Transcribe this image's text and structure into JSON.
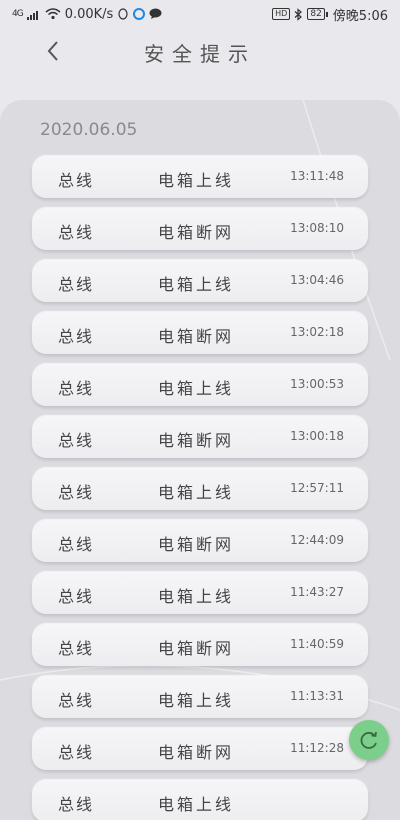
{
  "status_bar": {
    "signal": "4G",
    "speed": "0.00K/s",
    "hd": "HD",
    "battery": "82",
    "time": "傍晚5:06"
  },
  "header": {
    "back_icon": "chevron-left-icon",
    "title": "安全提示"
  },
  "date_label": "2020.06.05",
  "records": [
    {
      "source": "总线",
      "event": "电箱上线",
      "time": "13:11:48"
    },
    {
      "source": "总线",
      "event": "电箱断网",
      "time": "13:08:10"
    },
    {
      "source": "总线",
      "event": "电箱上线",
      "time": "13:04:46"
    },
    {
      "source": "总线",
      "event": "电箱断网",
      "time": "13:02:18"
    },
    {
      "source": "总线",
      "event": "电箱上线",
      "time": "13:00:53"
    },
    {
      "source": "总线",
      "event": "电箱断网",
      "time": "13:00:18"
    },
    {
      "source": "总线",
      "event": "电箱上线",
      "time": "12:57:11"
    },
    {
      "source": "总线",
      "event": "电箱断网",
      "time": "12:44:09"
    },
    {
      "source": "总线",
      "event": "电箱上线",
      "time": "11:43:27"
    },
    {
      "source": "总线",
      "event": "电箱断网",
      "time": "11:40:59"
    },
    {
      "source": "总线",
      "event": "电箱上线",
      "time": "11:13:31"
    },
    {
      "source": "总线",
      "event": "电箱断网",
      "time": "11:12:28"
    },
    {
      "source": "总线",
      "event": "电箱上线",
      "time": ""
    }
  ],
  "refresh_icon": "refresh-icon",
  "colors": {
    "background": "#e9e8ec",
    "panel": "#dcdbe0",
    "refresh_button": "#7ccf8b"
  }
}
